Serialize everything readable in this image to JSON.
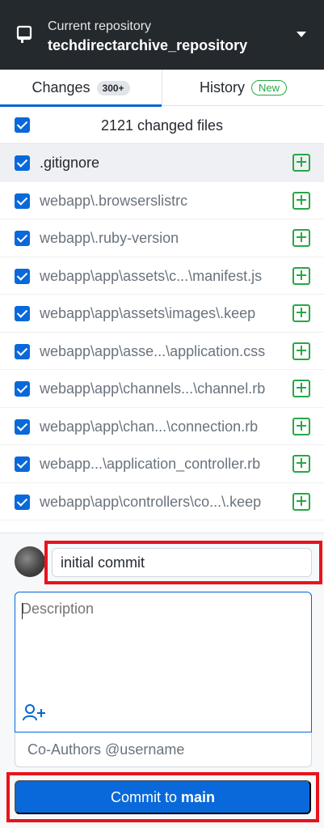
{
  "repository": {
    "label": "Current repository",
    "name": "techdirectarchive_repository",
    "icon": "repo-icon"
  },
  "tabs": [
    {
      "label": "Changes",
      "badge": "300+"
    },
    {
      "label": "History",
      "badge": "New"
    }
  ],
  "changes": {
    "summary": "2121 changed files",
    "files": [
      {
        "path": ".gitignore",
        "status": "added"
      },
      {
        "path": "webapp\\.browserslistrc",
        "status": "added"
      },
      {
        "path": "webapp\\.ruby-version",
        "status": "added"
      },
      {
        "path": "webapp\\app\\assets\\c...\\manifest.js",
        "status": "added"
      },
      {
        "path": "webapp\\app\\assets\\images\\.keep",
        "status": "added"
      },
      {
        "path": "webapp\\app\\asse...\\application.css",
        "status": "added"
      },
      {
        "path": "webapp\\app\\channels...\\channel.rb",
        "status": "added"
      },
      {
        "path": "webapp\\app\\chan...\\connection.rb",
        "status": "added"
      },
      {
        "path": "webapp...\\application_controller.rb",
        "status": "added"
      },
      {
        "path": "webapp\\app\\controllers\\co...\\.keep",
        "status": "added"
      }
    ]
  },
  "commit": {
    "summary_value": "initial commit",
    "description_placeholder": "Description",
    "coauthors_placeholder": "Co-Authors @username",
    "button_label": "Commit to",
    "branch": "main"
  },
  "colors": {
    "header_bg": "#24292e",
    "accent": "#0969da",
    "added": "#28a745",
    "highlight": "#e8131b"
  }
}
